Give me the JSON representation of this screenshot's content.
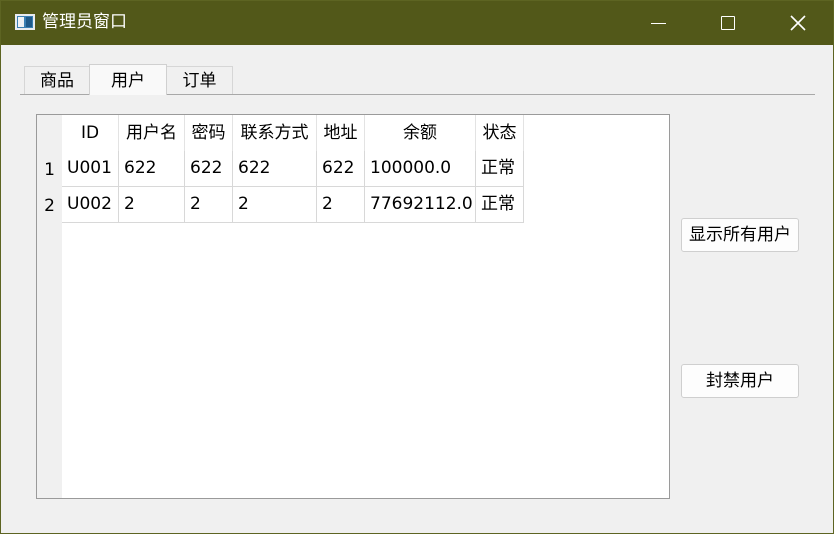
{
  "window": {
    "title": "管理员窗口",
    "controls": {
      "minimize": "minimize",
      "maximize": "maximize",
      "close": "close"
    }
  },
  "tabs": [
    {
      "label": "商品",
      "active": false
    },
    {
      "label": "用户",
      "active": true
    },
    {
      "label": "订单",
      "active": false
    }
  ],
  "table": {
    "columns": [
      "ID",
      "用户名",
      "密码",
      "联系方式",
      "地址",
      "余额",
      "状态"
    ],
    "row_numbers": [
      "1",
      "2"
    ],
    "rows": [
      [
        "U001",
        "622",
        "622",
        "622",
        "622",
        "100000.0",
        "正常"
      ],
      [
        "U002",
        "2",
        "2",
        "2",
        "2",
        "77692112.0",
        "正常"
      ]
    ]
  },
  "buttons": {
    "show_all": "显示所有用户",
    "ban": "封禁用户"
  }
}
